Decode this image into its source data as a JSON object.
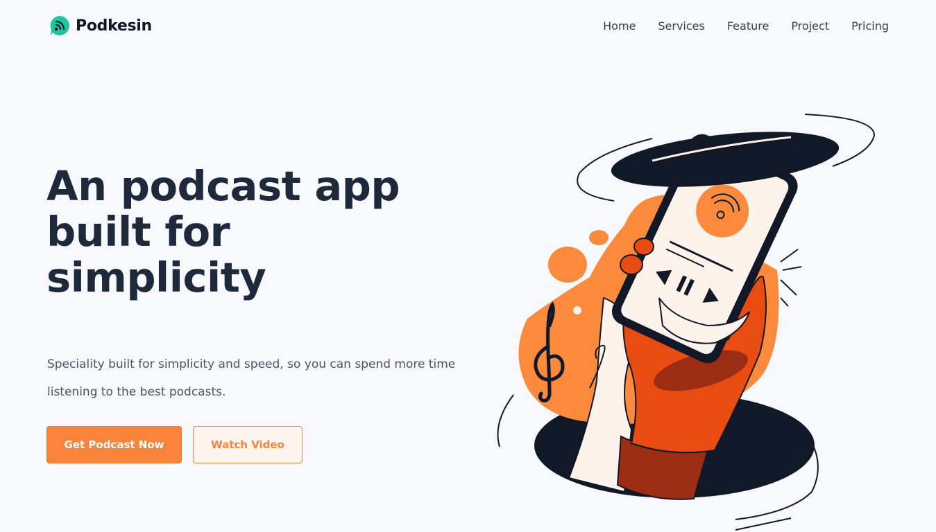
{
  "brand": {
    "name": "Podkesin",
    "icon": "podcast-signal-icon",
    "accent_color": "#1cc7a0"
  },
  "nav": {
    "items": [
      {
        "label": "Home"
      },
      {
        "label": "Services"
      },
      {
        "label": "Feature"
      },
      {
        "label": "Project"
      },
      {
        "label": "Pricing"
      }
    ]
  },
  "hero": {
    "title_lines": [
      "An podcast app",
      "built for",
      "simplicity"
    ],
    "subtitle": "Speciality built for simplicity and speed, so you can spend more time listening to the best podcasts.",
    "primary_button": "Get Podcast Now",
    "secondary_button": "Watch Video"
  },
  "colors": {
    "primary": "#f9843a",
    "dark": "#111827",
    "orange_deep": "#e84c10",
    "background": "#f8f9fc"
  }
}
